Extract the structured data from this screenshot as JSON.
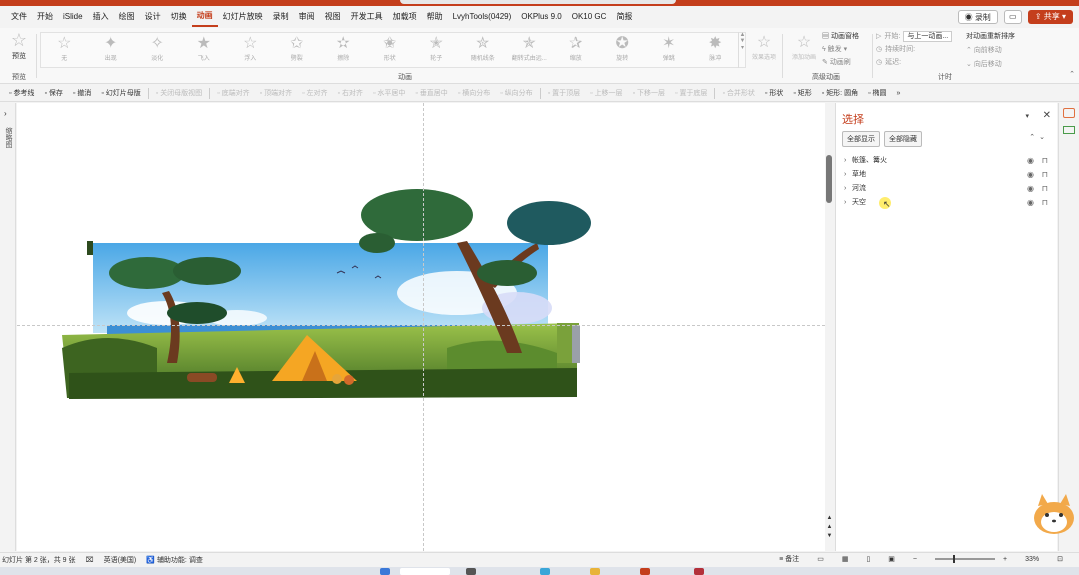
{
  "menubar": {
    "items": [
      "文件",
      "开始",
      "iSlide",
      "插入",
      "绘图",
      "设计",
      "切换",
      "动画",
      "幻灯片放映",
      "录制",
      "审阅",
      "视图",
      "开发工具",
      "加载项",
      "帮助",
      "LvyhTools(0429)",
      "OKPlus 9.0",
      "OK10 GC",
      "简报"
    ],
    "active_index": 7,
    "record_label": "录制",
    "share_label": "共享"
  },
  "ribbon": {
    "preview_label": "预览",
    "preview_group_label": "预览",
    "animation_group_label": "动画",
    "advanced_group_label": "高级动画",
    "timing_group_label": "计时",
    "animations": [
      "无",
      "出现",
      "淡化",
      "飞入",
      "浮入",
      "劈裂",
      "擦除",
      "形状",
      "轮子",
      "随机线条",
      "翻转式由远...",
      "缩放",
      "旋转",
      "弹跳",
      "脉冲"
    ],
    "effect_options_label": "效果选项",
    "add_animation_label": "添加动画",
    "advanced": [
      "动画窗格",
      "触发",
      "动画刷"
    ],
    "timing": {
      "start_label": "开始:",
      "start_value": "与上一动画...",
      "duration_label": "持续时间:",
      "delay_label": "延迟:"
    },
    "reorder": {
      "title": "对动画重新排序",
      "forward": "向前移动",
      "backward": "向后移动"
    }
  },
  "qat": {
    "items": [
      {
        "label": "参考线",
        "on": true
      },
      {
        "label": "保存",
        "on": true
      },
      {
        "label": "撤消",
        "on": true
      },
      {
        "label": "幻灯片母版",
        "on": true
      },
      {
        "label": "关闭母版视图",
        "on": false
      },
      {
        "label": "底端对齐",
        "on": false
      },
      {
        "label": "顶端对齐",
        "on": false
      },
      {
        "label": "左对齐",
        "on": false
      },
      {
        "label": "右对齐",
        "on": false
      },
      {
        "label": "水平居中",
        "on": false
      },
      {
        "label": "垂直居中",
        "on": false
      },
      {
        "label": "横向分布",
        "on": false
      },
      {
        "label": "纵向分布",
        "on": false
      },
      {
        "label": "置于顶层",
        "on": false
      },
      {
        "label": "上移一层",
        "on": false
      },
      {
        "label": "下移一层",
        "on": false
      },
      {
        "label": "置于底层",
        "on": false
      },
      {
        "label": "合并形状",
        "on": false
      },
      {
        "label": "形状",
        "on": true
      },
      {
        "label": "矩形",
        "on": true
      },
      {
        "label": "矩形: 圆角",
        "on": true
      },
      {
        "label": "椭圆",
        "on": true
      }
    ]
  },
  "thumb_strip": {
    "label": "缩略图"
  },
  "selection_pane": {
    "title": "选择",
    "show_all": "全部显示",
    "hide_all": "全部隐藏",
    "layers": [
      "帐篷、篝火",
      "草地",
      "河流",
      "天空"
    ]
  },
  "statusbar": {
    "slide_info": "幻灯片 第 2 张，共 9 张",
    "language": "英语(美国)",
    "accessibility": "辅助功能: 调查",
    "notes": "备注",
    "zoom": "33%"
  },
  "colors": {
    "accent": "#c43e1c",
    "sky": "#5ab4ec",
    "grass": "#4c7a2a",
    "tent": "#f5a623"
  }
}
